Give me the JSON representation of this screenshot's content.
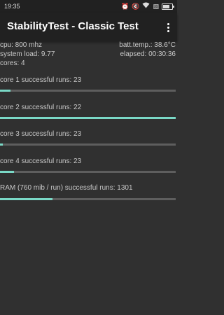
{
  "status_bar": {
    "time": "19:35",
    "icons": [
      "alarm-icon",
      "mute-icon",
      "wifi-icon",
      "battery-icon"
    ],
    "extra_glyph": "▨"
  },
  "app_bar": {
    "title": "StabilityTest - Classic Test",
    "menu_icon": "more-vert-icon"
  },
  "info": {
    "cpu": "cpu: 800 mhz",
    "batt_temp": "batt.temp.: 38.6°C",
    "system_load": "system load: 9.77",
    "elapsed": "elapsed: 00:30:36",
    "cores": "cores: 4"
  },
  "tests": [
    {
      "label": "core 1 successful runs: 23",
      "progress": 0.06
    },
    {
      "label": "core 2 successful runs: 22",
      "progress": 1.0
    },
    {
      "label": "core 3 successful runs: 23",
      "progress": 0.015
    },
    {
      "label": "core 4 successful runs: 23",
      "progress": 0.08
    },
    {
      "label": "RAM (760 mib / run) successful runs: 1301",
      "progress": 0.3
    }
  ],
  "colors": {
    "background": "#303030",
    "bar": "#212121",
    "accent": "#7ad8c6",
    "track": "#5e5e5e"
  }
}
